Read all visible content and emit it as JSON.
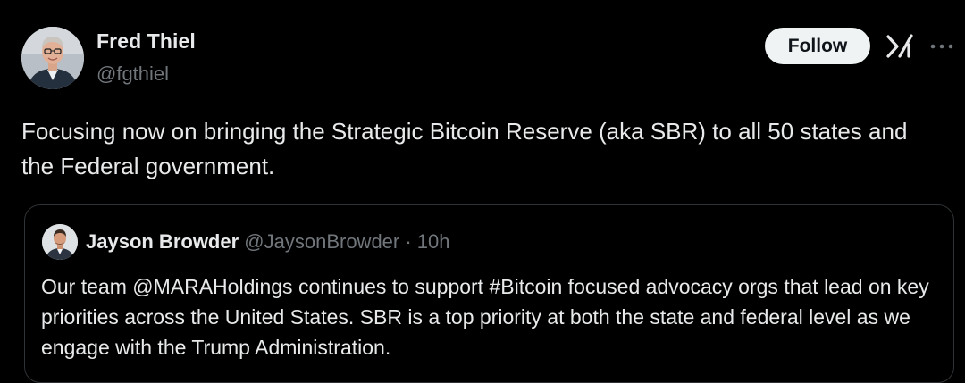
{
  "tweet": {
    "author": {
      "name": "Fred Thiel",
      "handle": "@fgthiel"
    },
    "follow_label": "Follow",
    "text": "Focusing now on bringing the Strategic Bitcoin Reserve (aka SBR) to all 50 states and the Federal government."
  },
  "quote": {
    "author_name": "Jayson Browder",
    "meta": " @JaysonBrowder · 10h",
    "text": "Our team @MARAHoldings continues to support #Bitcoin focused advocacy orgs that lead on key priorities across the United States. SBR is a top priority at both the state and federal level as we engage with the Trump Administration."
  },
  "icons": {
    "avatar": "profile-photo",
    "grok": "grok-icon",
    "more": "more-icon",
    "quote_avatar": "profile-photo"
  },
  "colors": {
    "background": "#000000",
    "text_primary": "#e7e9ea",
    "text_secondary": "#71767b",
    "follow_bg": "#eff3f4",
    "follow_text": "#0f1419",
    "card_border": "#2f3336"
  }
}
